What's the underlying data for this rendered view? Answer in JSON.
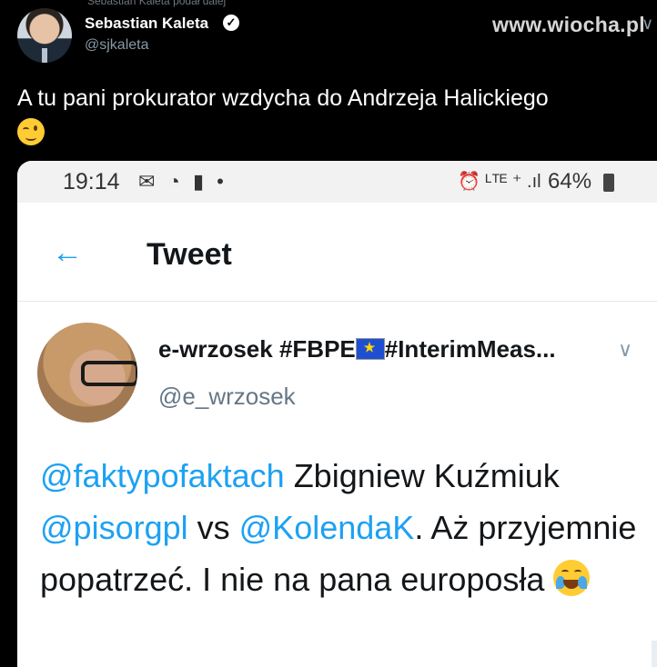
{
  "header": {
    "top_sliver": "Sebastian Kaleta podał dalej",
    "author_name": "Sebastian Kaleta",
    "verified_mark": "✓",
    "author_handle": "@sjkaleta",
    "watermark": "www.wiocha.pl",
    "menu_glyph": "∨"
  },
  "tweet": {
    "text": "A tu pani prokurator wzdycha do Andrzeja Halickiego"
  },
  "screenshot": {
    "status_bar": {
      "time": "19:14",
      "left_icons": "✉ ◔ ▮ •",
      "right_icons": "⏰ ᴸᵀᴱ ⁺ .ıl",
      "battery": "64%"
    },
    "app_bar": {
      "back": "←",
      "title": "Tweet"
    },
    "quoted": {
      "name": "e-wrzosek #FBPE",
      "name_suffix": "#InterimMeas...",
      "handle": "@e_wrzosek",
      "chevron": "∨",
      "mention1": "@faktypofaktach",
      "text1": " Zbigniew Kuźmiuk ",
      "mention2": "@pisorgpl",
      "text2": " vs ",
      "mention3": "@KolendaK",
      "text3": ". Aż przyjemnie popatrzeć. I nie na pana europosła "
    }
  }
}
